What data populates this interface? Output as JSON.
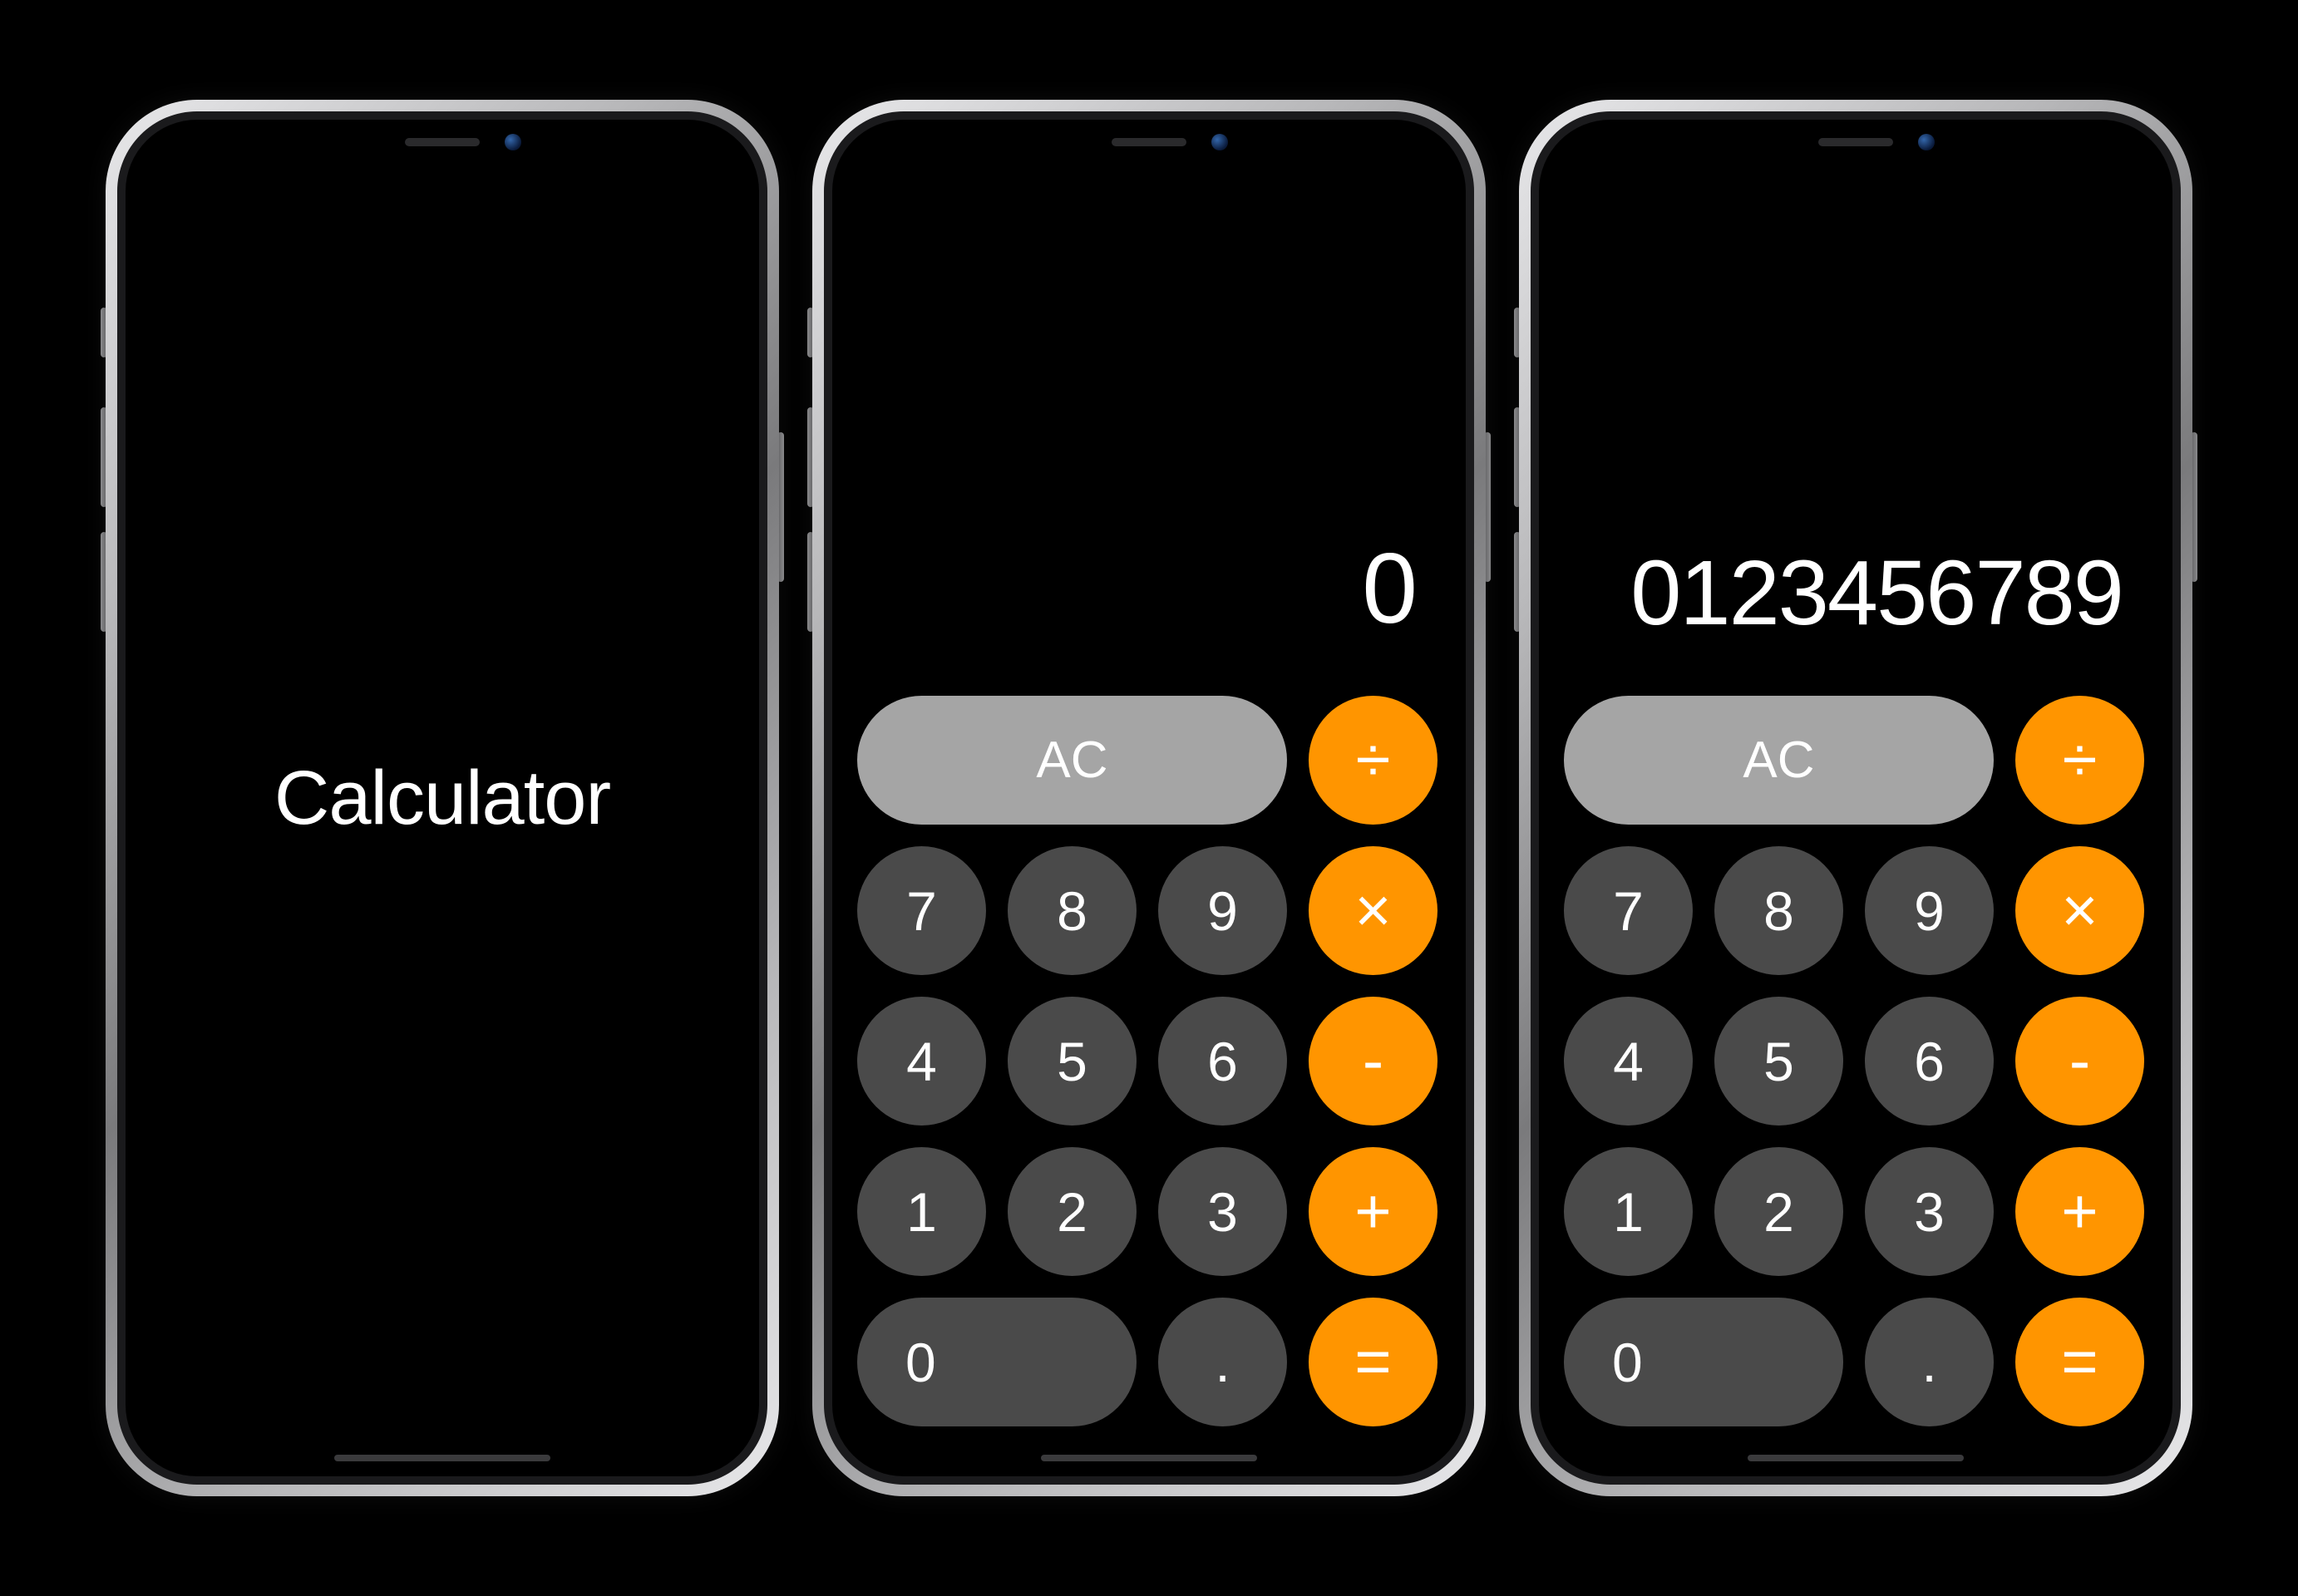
{
  "colors": {
    "operator": "#ff9500",
    "digit": "#4a4a4a",
    "function": "#a5a5a5",
    "background": "#000000",
    "text": "#ffffff"
  },
  "phones": [
    {
      "id": "splash",
      "splash_title": "Calculator"
    },
    {
      "id": "calc-zero",
      "display": "0",
      "keys": {
        "ac": "AC",
        "divide": "÷",
        "d7": "7",
        "d8": "8",
        "d9": "9",
        "multiply": "×",
        "d4": "4",
        "d5": "5",
        "d6": "6",
        "minus": "-",
        "d1": "1",
        "d2": "2",
        "d3": "3",
        "plus": "+",
        "d0": "0",
        "decimal": ".",
        "equals": "="
      }
    },
    {
      "id": "calc-digits",
      "display": "0123456789",
      "keys": {
        "ac": "AC",
        "divide": "÷",
        "d7": "7",
        "d8": "8",
        "d9": "9",
        "multiply": "×",
        "d4": "4",
        "d5": "5",
        "d6": "6",
        "minus": "-",
        "d1": "1",
        "d2": "2",
        "d3": "3",
        "plus": "+",
        "d0": "0",
        "decimal": ".",
        "equals": "="
      }
    }
  ]
}
